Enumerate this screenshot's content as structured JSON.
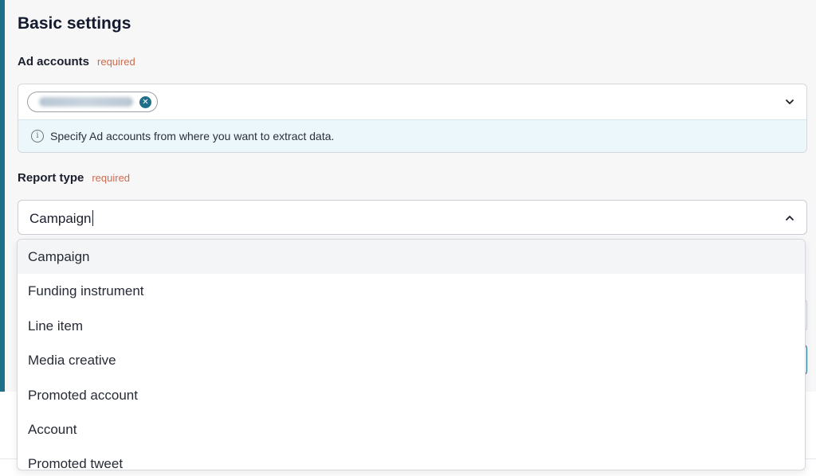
{
  "section": {
    "title": "Basic settings"
  },
  "ad_accounts": {
    "label": "Ad accounts",
    "required_text": "required",
    "chip_remove_icon": "close-circle-icon",
    "dropdown_icon": "chevron-down-icon",
    "info_icon": "info-icon",
    "info_text": "Specify Ad accounts from where you want to extract data."
  },
  "report_type": {
    "label": "Report type",
    "required_text": "required",
    "value": "Campaign",
    "dropdown_icon": "chevron-up-icon",
    "options": [
      "Campaign",
      "Funding instrument",
      "Line item",
      "Media creative",
      "Promoted account",
      "Account",
      "Promoted tweet"
    ],
    "highlighted_option": "Campaign"
  },
  "colors": {
    "accent": "#1f6f8b",
    "required": "#d06a4e",
    "info_background": "#ecf7fb"
  }
}
